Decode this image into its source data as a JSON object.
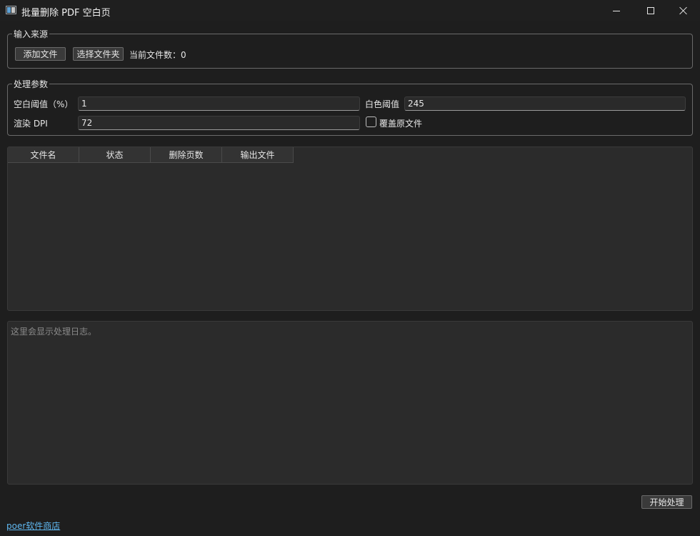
{
  "window": {
    "title": "批量删除 PDF 空白页",
    "controls": [
      "minimize-icon",
      "maximize-icon",
      "close-icon"
    ]
  },
  "input_source": {
    "legend": "输入来源",
    "add_files_label": "添加文件",
    "select_folder_label": "选择文件夹",
    "file_count_text": "当前文件数：0"
  },
  "params": {
    "legend": "处理参数",
    "blank_threshold_label": "空白阈值（%）",
    "blank_threshold_value": "1",
    "white_threshold_label": "白色阈值",
    "white_threshold_value": "245",
    "dpi_label": "渲染 DPI",
    "dpi_value": "72",
    "overwrite_label": "覆盖原文件",
    "overwrite_checked": false
  },
  "table": {
    "columns": [
      "文件名",
      "状态",
      "删除页数",
      "输出文件"
    ],
    "rows": []
  },
  "log": {
    "placeholder": "这里会显示处理日志。"
  },
  "actions": {
    "start_label": "开始处理"
  },
  "footer": {
    "store_link_text": "poer软件商店"
  },
  "colors": {
    "background": "#1e1e1e",
    "panel": "#2b2b2b",
    "link": "#5fb7f0",
    "border": "#6a6a6a"
  }
}
